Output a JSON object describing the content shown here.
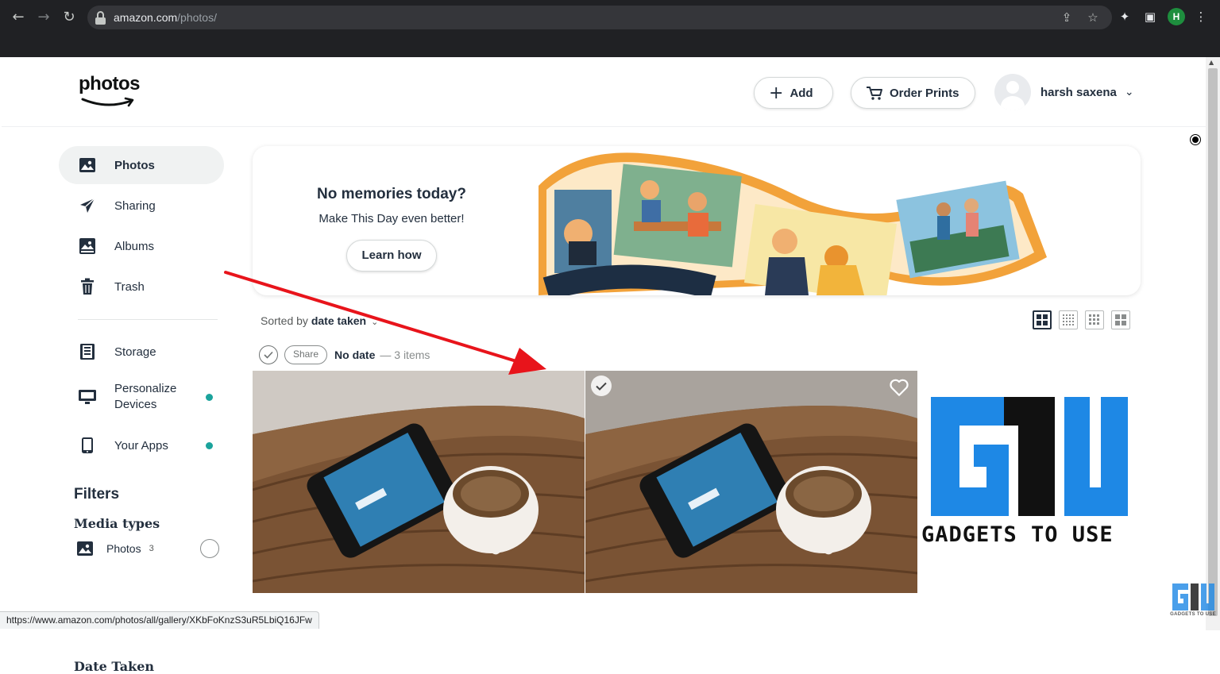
{
  "browser": {
    "url_host": "amazon.com",
    "url_path": "/photos/",
    "profile_initial": "H",
    "status_url": "https://www.amazon.com/photos/all/gallery/XKbFoKnzS3uR5LbiQ16JFw"
  },
  "header": {
    "logo_text": "photos",
    "add_label": "Add",
    "order_prints_label": "Order Prints",
    "user_name": "harsh saxena"
  },
  "sidebar": {
    "items": [
      {
        "label": "Photos"
      },
      {
        "label": "Sharing"
      },
      {
        "label": "Albums"
      },
      {
        "label": "Trash"
      },
      {
        "label": "Storage"
      },
      {
        "label": "Personalize Devices"
      },
      {
        "label": "Your Apps"
      }
    ],
    "filters_title": "Filters",
    "media_types_title": "Media types",
    "media_photos_label": "Photos",
    "media_photos_count": "3",
    "date_taken_title": "Date Taken"
  },
  "banner": {
    "title": "No memories today?",
    "subtitle": "Make This Day even better!",
    "cta": "Learn how"
  },
  "gallery": {
    "sort_prefix": "Sorted by",
    "sort_value": "date taken",
    "share_label": "Share",
    "group_title": "No date",
    "group_count": "— 3 items",
    "watermark_text": "GADGETS TO USE"
  },
  "colors": {
    "accent_teal": "#1ba39c",
    "arrow_red": "#e8141b",
    "gtu_blue": "#1e88e5"
  }
}
